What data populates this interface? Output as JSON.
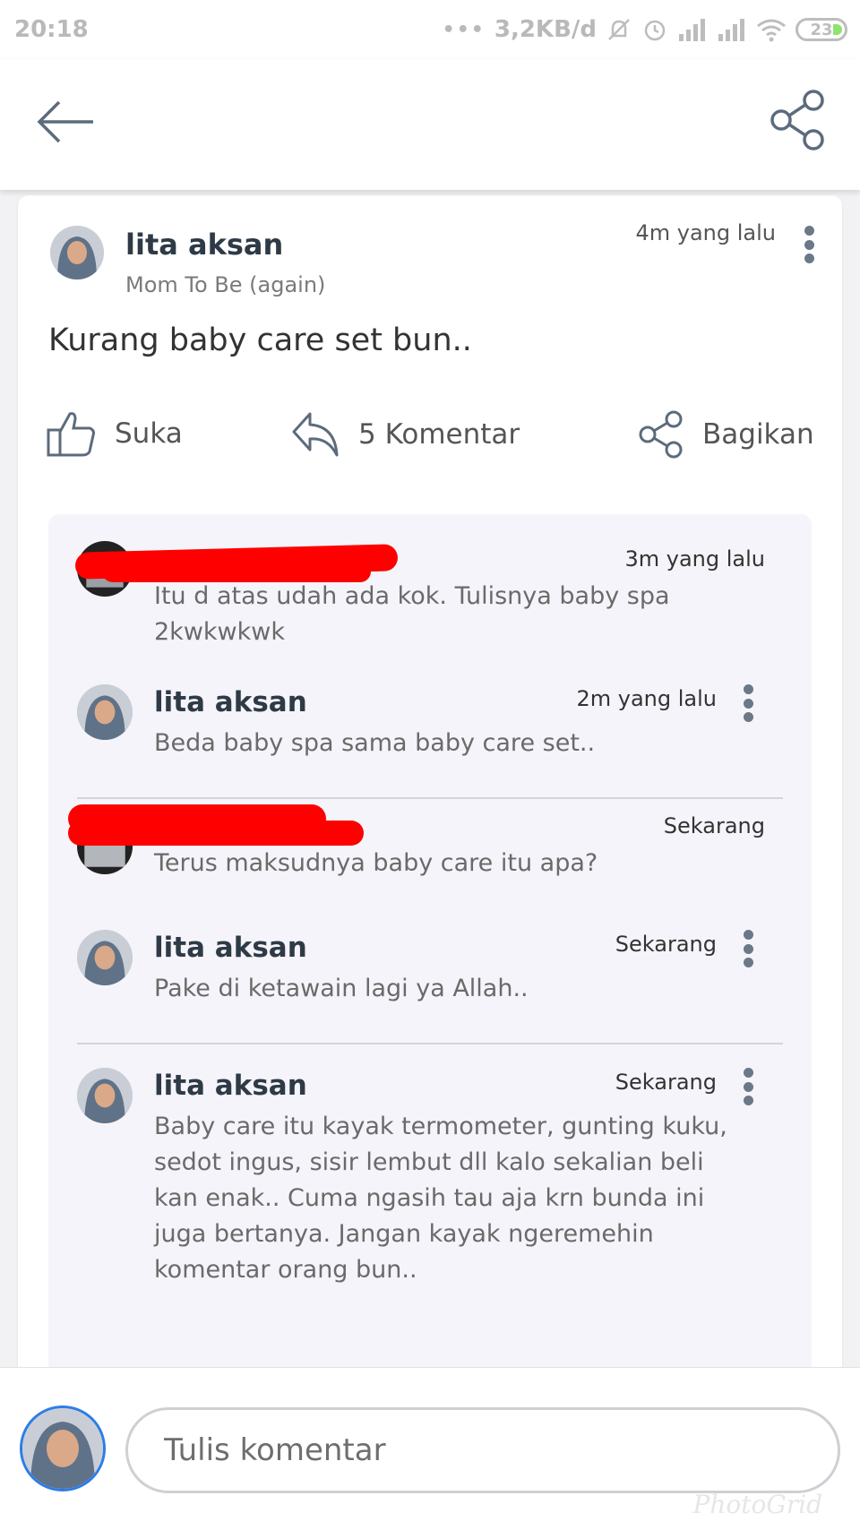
{
  "status_bar": {
    "time": "20:18",
    "dots": "•••",
    "network_speed": "3,2KB/d",
    "battery": "23"
  },
  "post": {
    "author_name": "lita aksan",
    "author_role": "Mom To Be (again)",
    "time": "4m yang lalu",
    "body": "Kurang baby care set bun..",
    "like_label": "Suka",
    "comment_label": "5 Komentar",
    "share_label": "Bagikan"
  },
  "comments": [
    {
      "time": "3m yang lalu",
      "text": "Itu d atas udah ada kok. Tulisnya baby spa 2kwkwkwk"
    },
    {
      "name": "lita aksan",
      "time": "2m yang lalu",
      "text": "Beda baby spa sama baby care set.."
    },
    {
      "time": "Sekarang",
      "text": "Terus maksudnya baby care itu apa?"
    },
    {
      "name": "lita aksan",
      "time": "Sekarang",
      "text": "Pake di ketawain lagi ya Allah.."
    },
    {
      "name": "lita aksan",
      "time": "Sekarang",
      "text": "Baby care itu kayak termometer, gunting kuku, sedot ingus, sisir lembut dll kalo sekalian beli kan enak.. Cuma ngasih tau aja krn bunda ini juga bertanya. Jangan kayak ngeremehin komentar orang bun.."
    }
  ],
  "composer": {
    "placeholder": "Tulis komentar"
  },
  "watermark": "PhotoGrid",
  "colors": {
    "accent_blue": "#2b7de9",
    "icon_gray": "#6b7888",
    "redaction": "#ff0000",
    "panel_bg": "#f5f4fa"
  }
}
